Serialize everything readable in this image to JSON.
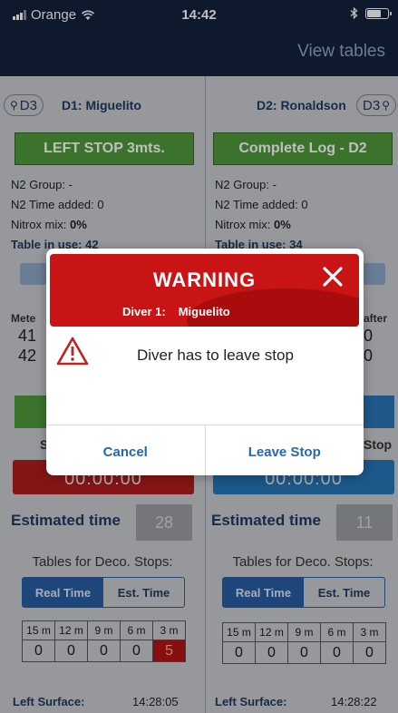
{
  "status_bar": {
    "carrier": "Orange",
    "time": "14:42"
  },
  "nav": {
    "view_tables": "View tables"
  },
  "diver1": {
    "badge": "D3",
    "title": "D1: Miguelito",
    "status_button": "LEFT STOP 3mts.",
    "n2_group": "N2 Group:  -",
    "n2_time": "N2 Time added: 0",
    "nitrox_label": "Nitrox mix: ",
    "nitrox_value": "0%",
    "table_in_use": "Table in use: 42",
    "meters_label": "Mete",
    "meter_val_1": "41",
    "meter_val_2": "42",
    "sub_label": "S",
    "timer": "00:00:00",
    "estimated_time_label": "Estimated time",
    "estimated_time_value": "28",
    "deco_label": "Tables for Deco. Stops:",
    "seg_real": "Real Time",
    "seg_est": "Est. Time",
    "stop_headers": [
      "15 m",
      "12 m",
      "9 m",
      "6 m",
      "3 m"
    ],
    "stop_values": [
      "0",
      "0",
      "0",
      "0",
      "5"
    ],
    "left_surface_label": "Left Surface:",
    "left_surface_time": "14:28:05"
  },
  "diver2": {
    "badge": "D3",
    "title": "D2: Ronaldson",
    "status_button": "Complete Log - D2",
    "n2_group": "N2 Group:  -",
    "n2_time": "N2 Time added: 0",
    "nitrox_label": "Nitrox mix: ",
    "nitrox_value": "0%",
    "table_in_use": "Table in use: 34",
    "meters_label": "after",
    "meter_val_1": "0",
    "meter_val_2": "0",
    "sub_label": "Stop",
    "timer": "00:00:00",
    "estimated_time_label": "Estimated time",
    "estimated_time_value": "11",
    "deco_label": "Tables for Deco. Stops:",
    "seg_real": "Real Time",
    "seg_est": "Est. Time",
    "stop_headers": [
      "15 m",
      "12 m",
      "9 m",
      "6 m",
      "3 m"
    ],
    "stop_values": [
      "0",
      "0",
      "0",
      "0",
      "0"
    ],
    "left_surface_label": "Left Surface:",
    "left_surface_time": "14:28:22"
  },
  "modal": {
    "title": "WARNING",
    "diver_label": "Diver 1:",
    "diver_name": "Miguelito",
    "message": "Diver has to leave stop",
    "cancel": "Cancel",
    "leave_stop": "Leave Stop"
  }
}
